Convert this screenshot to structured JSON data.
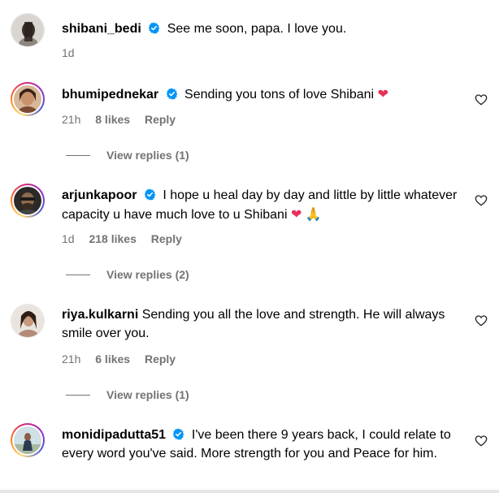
{
  "comments": [
    {
      "username": "shibani_bedi",
      "verified": true,
      "text": "See me soon, papa. I love you.",
      "time": "1d",
      "likes": "",
      "reply": ""
    },
    {
      "username": "bhumipednekar",
      "verified": true,
      "text": "Sending you tons of love Shibani",
      "emoji": "❤",
      "time": "21h",
      "likes": "8 likes",
      "reply": "Reply",
      "view_replies": "View replies (1)"
    },
    {
      "username": "arjunkapoor",
      "verified": true,
      "text": "I hope u heal day by day and little by little whatever capacity u have much love to u Shibani",
      "emoji": "❤",
      "emoji2": "🙏",
      "time": "1d",
      "likes": "218 likes",
      "reply": "Reply",
      "view_replies": "View replies (2)"
    },
    {
      "username": "riya.kulkarni",
      "verified": false,
      "text": "Sending you all the love and strength. He will always smile over you.",
      "time": "21h",
      "likes": "6 likes",
      "reply": "Reply",
      "view_replies": "View replies (1)"
    },
    {
      "username": "monidipadutta51",
      "verified": true,
      "text": "I've been there 9 years back, I could relate to every word you've said. More strength for you and Peace for him.",
      "time": "",
      "likes": "",
      "reply": ""
    }
  ],
  "icons": {
    "verified": "verified-badge-icon",
    "like": "heart-outline-icon"
  },
  "colors": {
    "verified": "#0095f6",
    "meta": "#737373",
    "heart_emoji": "#e8315a"
  }
}
